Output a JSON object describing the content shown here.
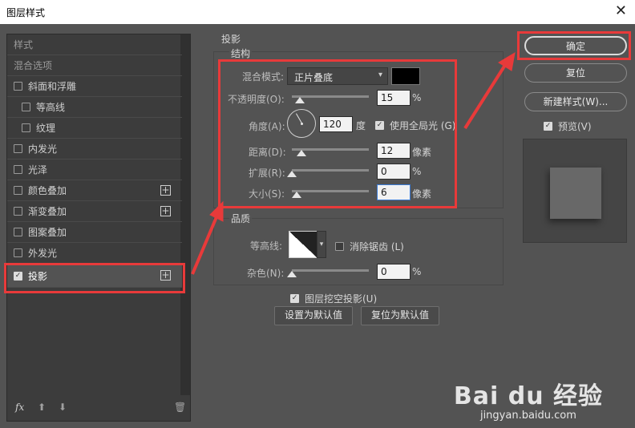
{
  "window": {
    "title": "图层样式"
  },
  "left_panel": {
    "items": [
      {
        "label": "样式",
        "header": true
      },
      {
        "label": "混合选项",
        "header": true
      },
      {
        "label": "斜面和浮雕",
        "checked": false
      },
      {
        "label": "等高线",
        "checked": false,
        "indent": true
      },
      {
        "label": "纹理",
        "checked": false,
        "indent": true
      },
      {
        "label": "内发光",
        "checked": false
      },
      {
        "label": "光泽",
        "checked": false
      },
      {
        "label": "颜色叠加",
        "checked": false,
        "plus": true
      },
      {
        "label": "渐变叠加",
        "checked": false,
        "plus": true
      },
      {
        "label": "图案叠加",
        "checked": false
      },
      {
        "label": "外发光",
        "checked": false
      },
      {
        "label": "投影",
        "checked": true,
        "plus": true,
        "active": true
      }
    ],
    "fx_label": "fx"
  },
  "drop_shadow": {
    "section_title": "投影",
    "structure": {
      "title": "结构",
      "blend_mode_label": "混合模式:",
      "blend_mode_value": "正片叠底",
      "shadow_color": "#000000",
      "opacity_label": "不透明度(O):",
      "opacity_value": "15",
      "opacity_unit": "%",
      "angle_label": "角度(A):",
      "angle_value": "120",
      "angle_unit": "度",
      "global_light_label": "使用全局光 (G)",
      "global_light_checked": true,
      "distance_label": "距离(D):",
      "distance_value": "12",
      "distance_unit": "像素",
      "spread_label": "扩展(R):",
      "spread_value": "0",
      "spread_unit": "%",
      "size_label": "大小(S):",
      "size_value": "6",
      "size_unit": "像素"
    },
    "quality": {
      "title": "品质",
      "contour_label": "等高线:",
      "anti_alias_label": "消除锯齿 (L)",
      "anti_alias_checked": false,
      "noise_label": "杂色(N):",
      "noise_value": "0",
      "noise_unit": "%"
    },
    "knockout_label": "图层挖空投影(U)",
    "knockout_checked": true,
    "set_default_label": "设置为默认值",
    "reset_default_label": "复位为默认值"
  },
  "right_panel": {
    "ok_label": "确定",
    "reset_label": "复位",
    "new_style_label": "新建样式(W)...",
    "preview_label": "预览(V)",
    "preview_checked": true
  },
  "watermark": {
    "brand": "Bai du 经验",
    "url": "jingyan.baidu.com"
  }
}
